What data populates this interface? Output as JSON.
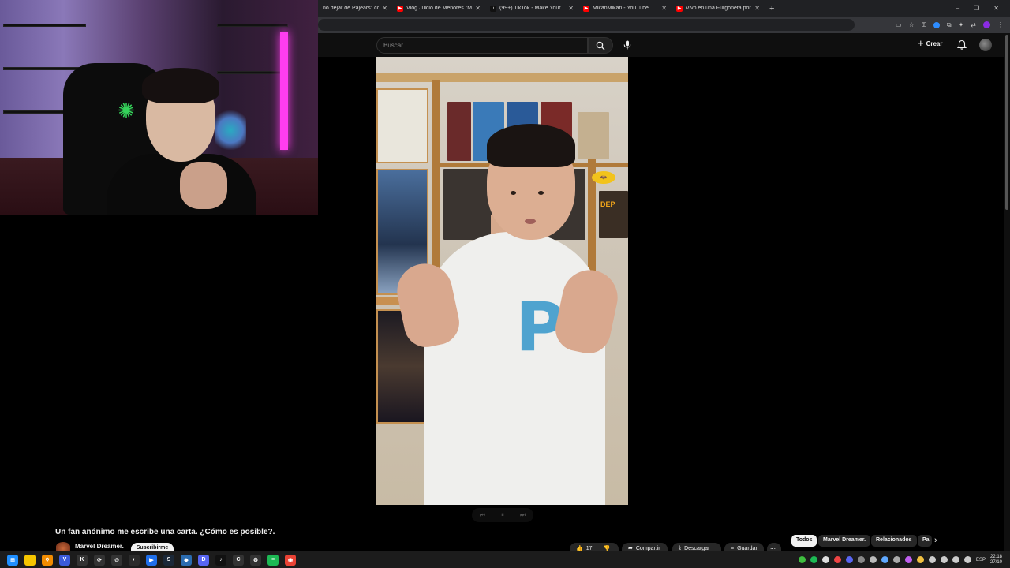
{
  "browser": {
    "tabs": [
      {
        "title": "no dejar de Pajears\" como",
        "favicon": "youtube-icon",
        "color": "#ff0000"
      },
      {
        "title": "Vlog Juicio de Menores \"Me Ca",
        "favicon": "youtube-icon",
        "color": "#ff0000"
      },
      {
        "title": "(99+) TikTok - Make Your Day",
        "favicon": "tiktok-icon",
        "color": "#111111"
      },
      {
        "title": "MikanMikan - YouTube",
        "favicon": "youtube-icon",
        "color": "#ff0000",
        "active": true
      },
      {
        "title": "Vivo en una Furgoneta por culp",
        "favicon": "youtube-icon",
        "color": "#ff0000"
      }
    ],
    "new_tab": "+",
    "window_controls": [
      "–",
      "❐",
      "✕"
    ]
  },
  "youtube": {
    "search": {
      "placeholder": "Buscar"
    },
    "create_label": "Crear",
    "video": {
      "title": "Un fan anónimo me escribe una carta. ¿Cómo es posible?.",
      "channel": "Marvel Dreamer.",
      "subscribe_label": "Suscribirme",
      "shirt_letter": "P",
      "sign_text": "DEP",
      "actions": {
        "likes": "17",
        "share": "Compartir",
        "download": "Descargar",
        "save": "Guardar"
      }
    },
    "chips": [
      "Todos",
      "Marvel Dreamer.",
      "Relacionados",
      "Pa"
    ]
  },
  "taskbar": {
    "apps": [
      {
        "name": "start-icon",
        "color": "#1f8fff",
        "glyph": "⊞"
      },
      {
        "name": "sticky-notes-icon",
        "color": "#f7c600",
        "glyph": ""
      },
      {
        "name": "search-app-icon",
        "color": "#f28c00",
        "glyph": "⚲"
      },
      {
        "name": "vivaldi-icon",
        "color": "#3b5bdb",
        "glyph": "V"
      },
      {
        "name": "app-4-icon",
        "color": "#333333",
        "glyph": "K"
      },
      {
        "name": "app-5-icon",
        "color": "#333333",
        "glyph": "⟳"
      },
      {
        "name": "app-6-icon",
        "color": "#333333",
        "glyph": "⊙"
      },
      {
        "name": "app-7-icon",
        "color": "#2b2b2b",
        "glyph": "◐"
      },
      {
        "name": "app-8-icon",
        "color": "#1f6feb",
        "glyph": "▶"
      },
      {
        "name": "steam-icon",
        "color": "#1b2838",
        "glyph": "S"
      },
      {
        "name": "app-10-icon",
        "color": "#2b6cb0",
        "glyph": "◆"
      },
      {
        "name": "discord-icon",
        "color": "#5865f2",
        "glyph": "D"
      },
      {
        "name": "tiktok-app-icon",
        "color": "#111111",
        "glyph": "♪"
      },
      {
        "name": "app-13-icon",
        "color": "#333333",
        "glyph": "C"
      },
      {
        "name": "app-14-icon",
        "color": "#333333",
        "glyph": "⚙"
      },
      {
        "name": "spotify-icon",
        "color": "#1db954",
        "glyph": "≡"
      },
      {
        "name": "chrome-icon",
        "color": "#ea4335",
        "glyph": "◉"
      }
    ],
    "tray": {
      "language": "ESP",
      "time": "22:18",
      "date": "27/10"
    }
  }
}
